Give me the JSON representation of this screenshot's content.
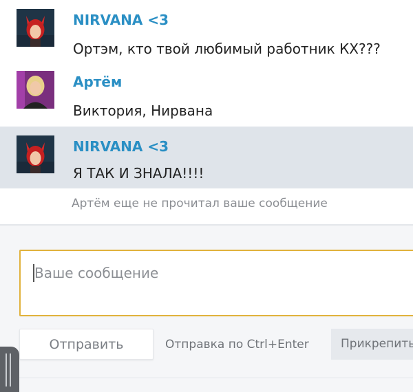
{
  "messages": [
    {
      "author": "NIRVANA <3",
      "text": "Ортэм, кто твой любимый работник КХ???",
      "avatar": "nirvana-avatar",
      "highlighted": false
    },
    {
      "author": "Артём",
      "text": "Виктория, Нирвана",
      "avatar": "artyom-avatar",
      "highlighted": false
    },
    {
      "author": "NIRVANA <3",
      "text": "Я ТАК И ЗНАЛА!!!!",
      "avatar": "nirvana-avatar",
      "highlighted": true
    }
  ],
  "read_status": "Артём еще не прочитал ваше сообщение",
  "composer": {
    "placeholder": "Ваше сообщение",
    "send_label": "Отправить",
    "send_hint": "Отправка по Ctrl+Enter",
    "attach_label": "Прикрепить"
  },
  "colors": {
    "author": "#2a8fc4",
    "highlight_row": "#dfe4ea",
    "input_border": "#e1b23c"
  }
}
